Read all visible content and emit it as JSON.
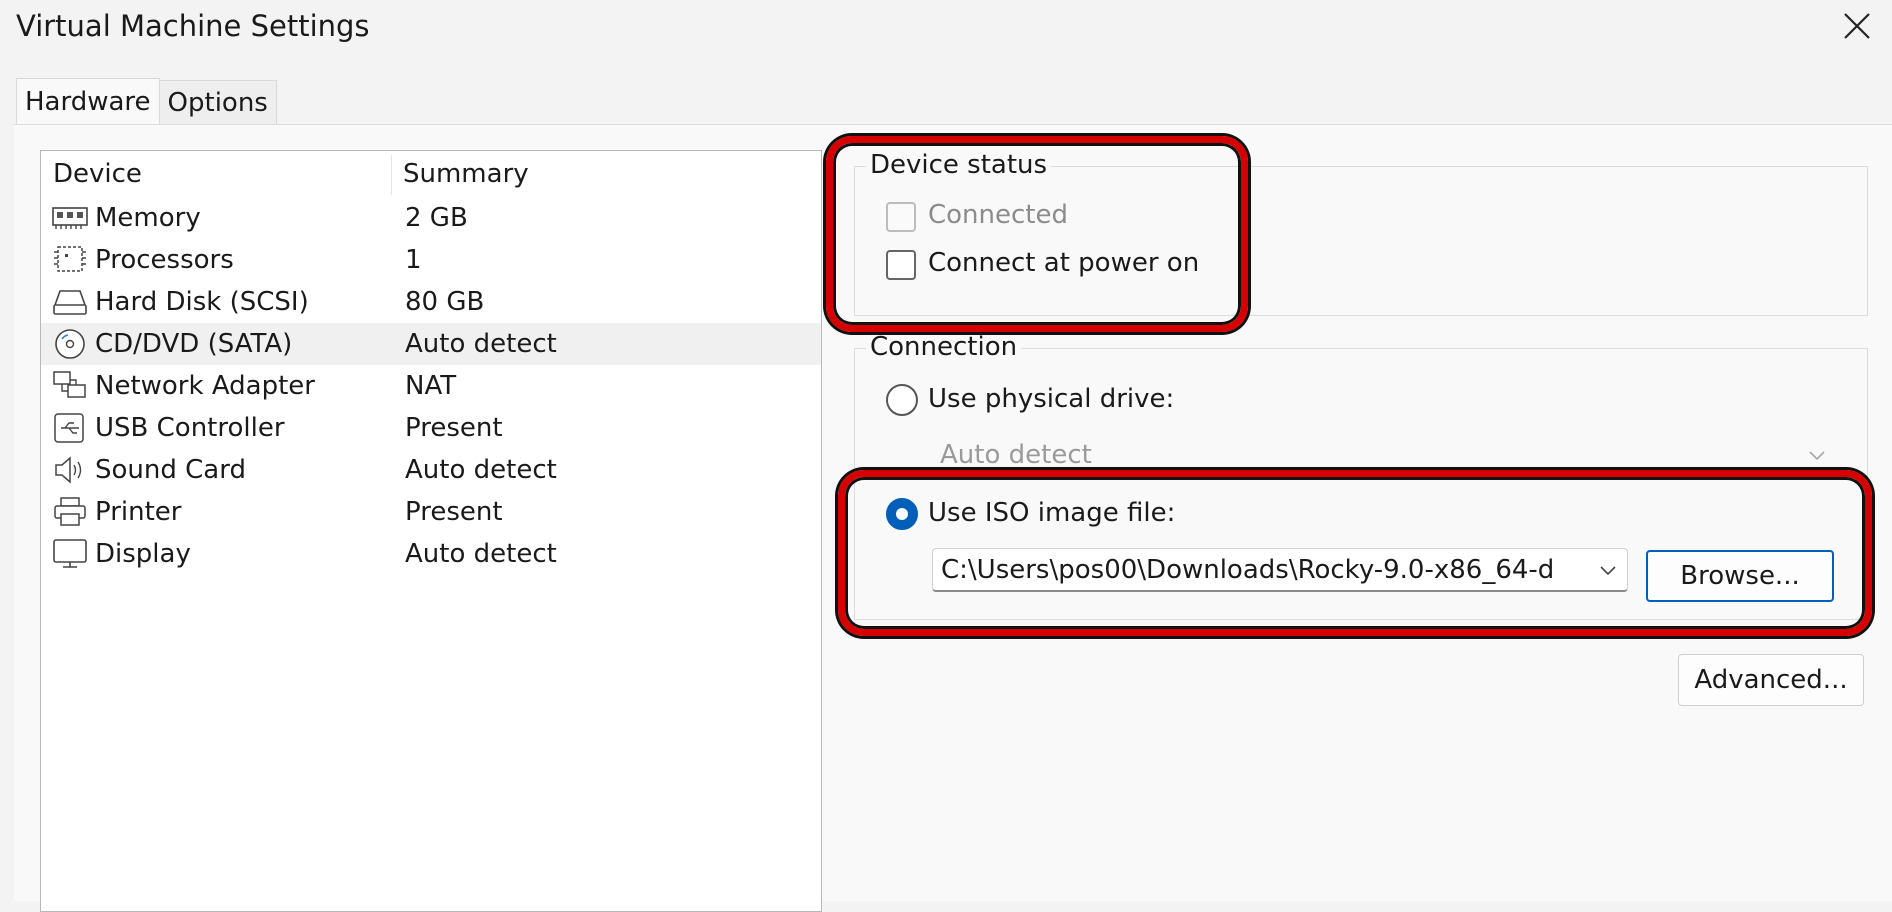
{
  "window": {
    "title": "Virtual Machine Settings"
  },
  "tabs": [
    {
      "label": "Hardware",
      "active": true
    },
    {
      "label": "Options",
      "active": false
    }
  ],
  "device_list": {
    "columns": [
      "Device",
      "Summary"
    ],
    "rows": [
      {
        "icon": "memory-icon",
        "name": "Memory",
        "summary": "2 GB"
      },
      {
        "icon": "processor-icon",
        "name": "Processors",
        "summary": "1"
      },
      {
        "icon": "hard-disk-icon",
        "name": "Hard Disk (SCSI)",
        "summary": "80 GB"
      },
      {
        "icon": "cd-dvd-icon",
        "name": "CD/DVD (SATA)",
        "summary": "Auto detect",
        "selected": true
      },
      {
        "icon": "network-adapter-icon",
        "name": "Network Adapter",
        "summary": "NAT"
      },
      {
        "icon": "usb-icon",
        "name": "USB Controller",
        "summary": "Present"
      },
      {
        "icon": "speaker-icon",
        "name": "Sound Card",
        "summary": "Auto detect"
      },
      {
        "icon": "printer-icon",
        "name": "Printer",
        "summary": "Present"
      },
      {
        "icon": "display-icon",
        "name": "Display",
        "summary": "Auto detect"
      }
    ]
  },
  "device_status": {
    "label": "Device status",
    "connected_label": "Connected",
    "connect_at_power_on_label": "Connect at power on"
  },
  "connection": {
    "label": "Connection",
    "physical_drive_label": "Use physical drive:",
    "physical_drive_value": "Auto detect",
    "iso_label": "Use ISO image file:",
    "iso_path": "C:\\Users\\pos00\\Downloads\\Rocky-9.0-x86_64-d",
    "browse_label": "Browse..."
  },
  "advanced_label": "Advanced...",
  "colors": {
    "accent": "#005fb8",
    "highlight": "#d70000"
  }
}
